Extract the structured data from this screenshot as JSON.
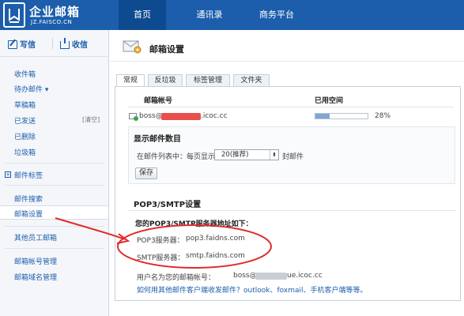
{
  "logo": {
    "title": "企业邮箱",
    "subtitle": "JZ.FAISCO.CN",
    "icon": "mail-logo-icon"
  },
  "nav": {
    "items": [
      {
        "label": "首页"
      },
      {
        "label": "通讯录"
      },
      {
        "label": "商务平台"
      }
    ]
  },
  "sidebar": {
    "compose_label": "写信",
    "receive_label": "收信",
    "folders": [
      {
        "label": "收件箱"
      },
      {
        "label": "待办邮件 ▾"
      },
      {
        "label": "草稿箱"
      },
      {
        "label": "已发送"
      },
      {
        "label": "已删除"
      },
      {
        "label": "垃圾箱"
      }
    ],
    "clear_label": "[清空]",
    "tags_label": "邮件标签",
    "tools": [
      {
        "label": "邮件搜索"
      },
      {
        "label": "邮箱设置"
      }
    ],
    "other_label": "其他员工邮箱",
    "admin": [
      {
        "label": "邮箱帐号管理"
      },
      {
        "label": "邮箱域名管理"
      }
    ]
  },
  "page": {
    "title": "邮箱设置",
    "icon": "mail-settings-icon"
  },
  "tabs": [
    {
      "label": "常规"
    },
    {
      "label": "反垃圾"
    },
    {
      "label": "标签管理"
    },
    {
      "label": "文件夹"
    }
  ],
  "account": {
    "col_account": "邮箱帐号",
    "col_used": "已用空间",
    "email_prefix": "boss@",
    "email_suffix": ".icoc.cc",
    "used_percent": 28,
    "used_label": "28%"
  },
  "display": {
    "heading": "显示邮件数目",
    "per_page_prefix": "在邮件列表中：每页显示",
    "per_page_value": "20(推荐)",
    "per_page_suffix": "封邮件",
    "save_label": "保存"
  },
  "pop": {
    "heading": "POP3/SMTP设置",
    "subheading": "您的POP3/SMTP服务器地址如下：",
    "pop3_label": "POP3服务器：",
    "pop3_value": "pop3.faidns.com",
    "smtp_label": "SMTP服务器：",
    "smtp_value": "smtp.faidns.com",
    "username_label": "用户名为您的邮箱帐号：",
    "username_prefix": "boss@",
    "username_suffix": "ue.icoc.cc",
    "help_link": "如何用其他邮件客户端收发邮件？outlook、foxmail、手机客户端等等。"
  },
  "colors": {
    "brand": "#1c5eab",
    "annotation": "#e02c2c",
    "progress": "#7fa6d6"
  }
}
